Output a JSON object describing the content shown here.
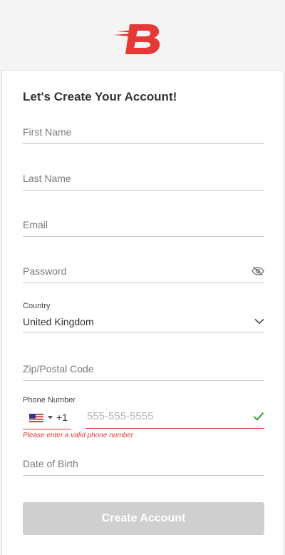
{
  "header": {
    "logo_letter": "B"
  },
  "form": {
    "title": "Let's Create Your Account!",
    "first_name_placeholder": "First Name",
    "last_name_placeholder": "Last Name",
    "email_placeholder": "Email",
    "password_placeholder": "Password",
    "country_label": "Country",
    "country_value": "United Kingdom",
    "zip_placeholder": "Zip/Postal Code",
    "phone_label": "Phone Number",
    "phone_dial_code": "+1",
    "phone_placeholder": "555-555-5555",
    "phone_error": "Please enter a valid phone number",
    "dob_placeholder": "Date of Birth",
    "submit_label": "Create Account"
  },
  "icons": {
    "password_toggle": "eye-slash-icon",
    "country_dropdown": "chevron-down-icon",
    "phone_flag": "us-flag-icon",
    "phone_valid": "checkmark-icon"
  },
  "colors": {
    "brand_red": "#e53935",
    "valid_green": "#43a047",
    "button_disabled": "#cfcfcf"
  }
}
